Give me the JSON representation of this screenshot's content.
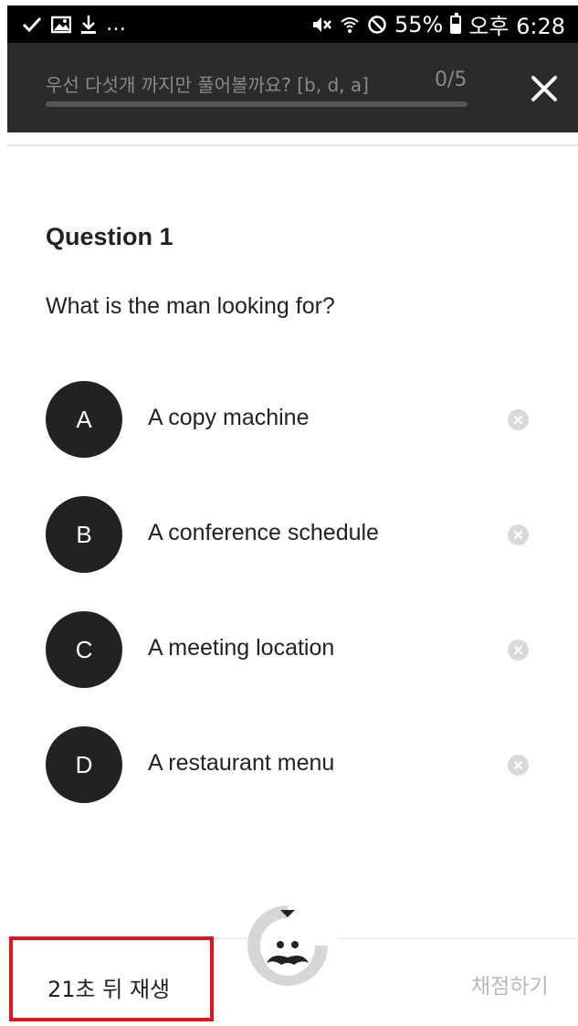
{
  "status_bar": {
    "battery": "55%",
    "time": "오후 6:28",
    "battery_level": 0.55,
    "icons_left": [
      "check-icon",
      "image-icon",
      "download-icon",
      "more-dots"
    ],
    "icons_right": [
      "mute-vibrate-icon",
      "wifi-icon",
      "blocked-icon",
      "battery-icon"
    ],
    "more": "…"
  },
  "header": {
    "title": "우선 다섯개 까지만 풀어볼까요? [b, d, a]",
    "counter": "0/5",
    "progress": 0,
    "close_icon": "close-icon"
  },
  "question": {
    "heading": "Question 1",
    "text": "What is the man looking for?"
  },
  "options": [
    {
      "letter": "A",
      "text": "A copy machine"
    },
    {
      "letter": "B",
      "text": "A conference schedule"
    },
    {
      "letter": "C",
      "text": "A meeting location"
    },
    {
      "letter": "D",
      "text": "A restaurant menu"
    }
  ],
  "footer": {
    "replay_label": "21초 뒤 재생",
    "grade_label": "채점하기",
    "mascot_icon": "mustache-mascot-icon"
  },
  "colors": {
    "header_bg": "#2b2b2b",
    "option_circle": "#222222",
    "highlight": "#e3131b",
    "muted": "#b8b8b8"
  }
}
